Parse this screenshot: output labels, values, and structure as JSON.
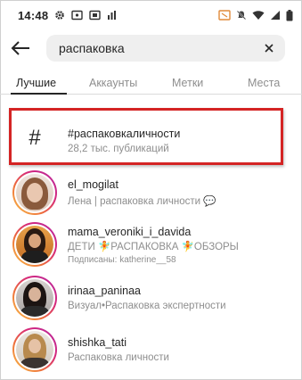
{
  "status_bar": {
    "time": "14:48",
    "left_icons": [
      "gear-icon",
      "cast-icon",
      "cast-box-icon",
      "chart-icon"
    ],
    "right_icons": [
      "mute-icon",
      "wifi-icon",
      "signal-icon",
      "battery-icon"
    ]
  },
  "search": {
    "query": "распаковка"
  },
  "tabs": [
    {
      "label": "Лучшие",
      "active": true
    },
    {
      "label": "Аккаунты",
      "active": false
    },
    {
      "label": "Метки",
      "active": false
    },
    {
      "label": "Места",
      "active": false
    }
  ],
  "results": {
    "hashtag": {
      "symbol": "#",
      "title": "#распаковкаличности",
      "subtitle": "28,2 тыс. публикаций"
    },
    "accounts": [
      {
        "username": "el_mogilat",
        "subtitle": "Лена | распаковка личности 💬"
      },
      {
        "username": "mama_veroniki_i_davida",
        "subtitle": "ДЕТИ 🧚РАСПАКОВКА 🧚ОБЗОРЫ",
        "subtitle2": "Подписаны: katherine__58"
      },
      {
        "username": "irinaa_paninaa",
        "subtitle": "Визуал•Распаковка экспертности"
      },
      {
        "username": "shishka_tati",
        "subtitle": "Распаковка личности"
      }
    ]
  },
  "colors": {
    "highlight": "#d42424",
    "ring_start": "#f9c54a",
    "ring_end": "#b42aa5",
    "muted_text": "#8e8e8e"
  }
}
